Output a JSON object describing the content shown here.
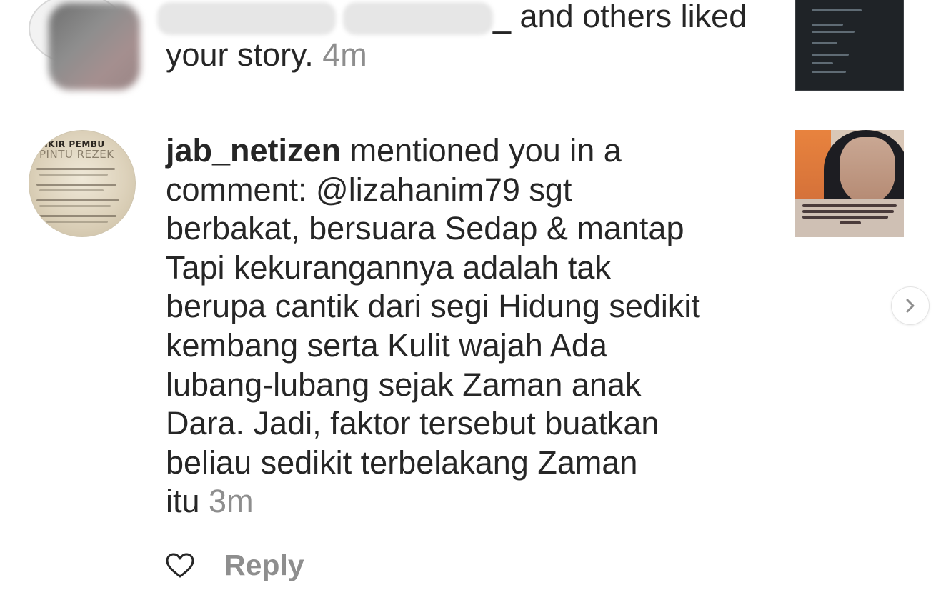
{
  "notifications": [
    {
      "type": "story_like",
      "suffix": "_ and others liked",
      "line2": "your story.",
      "time": "4m"
    },
    {
      "type": "mention",
      "username": "jab_netizen",
      "line1_rest": " mentioned you in a",
      "comment_lines": [
        "comment: @lizahanim79 sgt",
        "berbakat, bersuara Sedap & mantap",
        "Tapi kekurangannya adalah tak",
        "berupa cantik dari segi Hidung sedikit",
        "kembang serta Kulit wajah Ada",
        "lubang-lubang sejak Zaman anak",
        "Dara. Jadi, faktor tersebut buatkan",
        "beliau sedikit terbelakang Zaman"
      ],
      "last_word": "itu",
      "time": "3m",
      "avatar_text": {
        "title": "ZIKIR PEMBU",
        "subtitle": "PINTU REZEK"
      }
    }
  ],
  "actions": {
    "reply_label": "Reply",
    "like_icon": "heart-outline-icon"
  },
  "carousel": {
    "next_icon": "chevron-right-icon"
  },
  "colors": {
    "text": "#262626",
    "muted": "#8e8e8e",
    "background": "#ffffff"
  }
}
